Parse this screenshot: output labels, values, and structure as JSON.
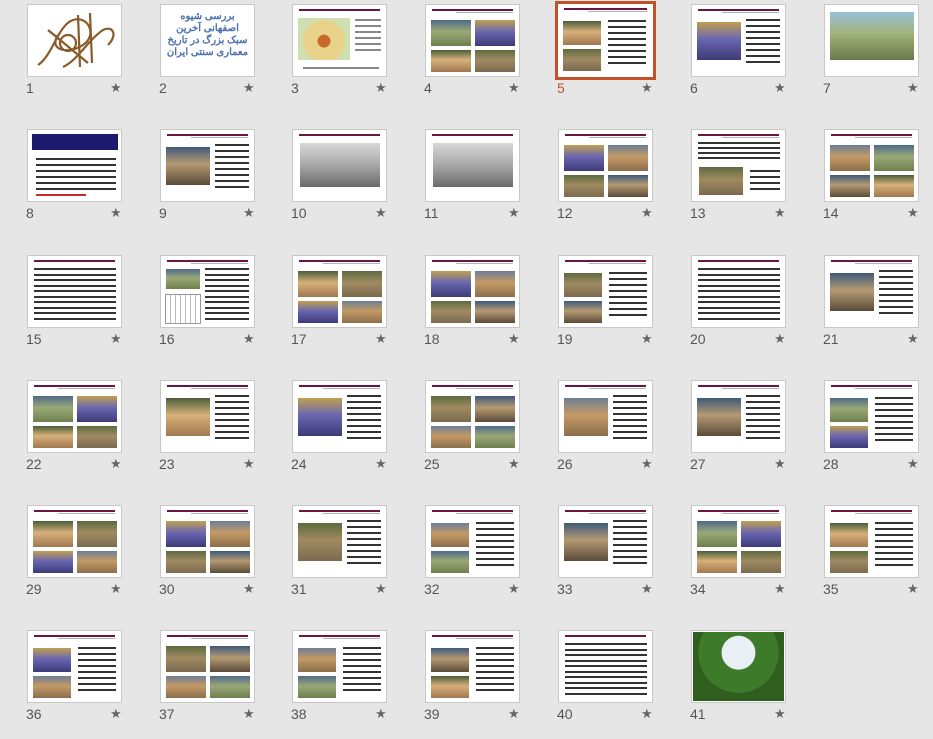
{
  "slide_panel": {
    "selected_slide": 5,
    "slide2_title": "بررسی شیوه اصفهانی آخرین سبک بزرگ در تاریخ معماری سنتی ایران",
    "slides": [
      {
        "number": "1",
        "star": "★",
        "kind": "logo"
      },
      {
        "number": "2",
        "star": "★",
        "kind": "title"
      },
      {
        "number": "3",
        "star": "★",
        "kind": "map"
      },
      {
        "number": "4",
        "star": "★",
        "kind": "photos"
      },
      {
        "number": "5",
        "star": "★",
        "kind": "photos-text"
      },
      {
        "number": "6",
        "star": "★",
        "kind": "photo-text"
      },
      {
        "number": "7",
        "star": "★",
        "kind": "aerial"
      },
      {
        "number": "8",
        "star": "★",
        "kind": "text-blue"
      },
      {
        "number": "9",
        "star": "★",
        "kind": "photo-text"
      },
      {
        "number": "10",
        "star": "★",
        "kind": "old-photo"
      },
      {
        "number": "11",
        "star": "★",
        "kind": "old-photo"
      },
      {
        "number": "12",
        "star": "★",
        "kind": "photos"
      },
      {
        "number": "13",
        "star": "★",
        "kind": "text-photo"
      },
      {
        "number": "14",
        "star": "★",
        "kind": "photos"
      },
      {
        "number": "15",
        "star": "★",
        "kind": "text"
      },
      {
        "number": "16",
        "star": "★",
        "kind": "plan-text"
      },
      {
        "number": "17",
        "star": "★",
        "kind": "photos"
      },
      {
        "number": "18",
        "star": "★",
        "kind": "photos"
      },
      {
        "number": "19",
        "star": "★",
        "kind": "photos-text"
      },
      {
        "number": "20",
        "star": "★",
        "kind": "text"
      },
      {
        "number": "21",
        "star": "★",
        "kind": "photo-text"
      },
      {
        "number": "22",
        "star": "★",
        "kind": "photos"
      },
      {
        "number": "23",
        "star": "★",
        "kind": "photo-text"
      },
      {
        "number": "24",
        "star": "★",
        "kind": "photo-text"
      },
      {
        "number": "25",
        "star": "★",
        "kind": "photos"
      },
      {
        "number": "26",
        "star": "★",
        "kind": "photo-text"
      },
      {
        "number": "27",
        "star": "★",
        "kind": "photo-text"
      },
      {
        "number": "28",
        "star": "★",
        "kind": "photos-text"
      },
      {
        "number": "29",
        "star": "★",
        "kind": "photos"
      },
      {
        "number": "30",
        "star": "★",
        "kind": "photos"
      },
      {
        "number": "31",
        "star": "★",
        "kind": "photo-text"
      },
      {
        "number": "32",
        "star": "★",
        "kind": "photos-text"
      },
      {
        "number": "33",
        "star": "★",
        "kind": "photo-text"
      },
      {
        "number": "34",
        "star": "★",
        "kind": "photos"
      },
      {
        "number": "35",
        "star": "★",
        "kind": "photos-text"
      },
      {
        "number": "36",
        "star": "★",
        "kind": "photos-text"
      },
      {
        "number": "37",
        "star": "★",
        "kind": "photos"
      },
      {
        "number": "38",
        "star": "★",
        "kind": "photos-text"
      },
      {
        "number": "39",
        "star": "★",
        "kind": "photos-text"
      },
      {
        "number": "40",
        "star": "★",
        "kind": "text"
      },
      {
        "number": "41",
        "star": "★",
        "kind": "garden"
      }
    ]
  },
  "colors": {
    "selection_border": "#c4502a",
    "background": "#e6e6e6",
    "header_bar": "#6b1640"
  }
}
